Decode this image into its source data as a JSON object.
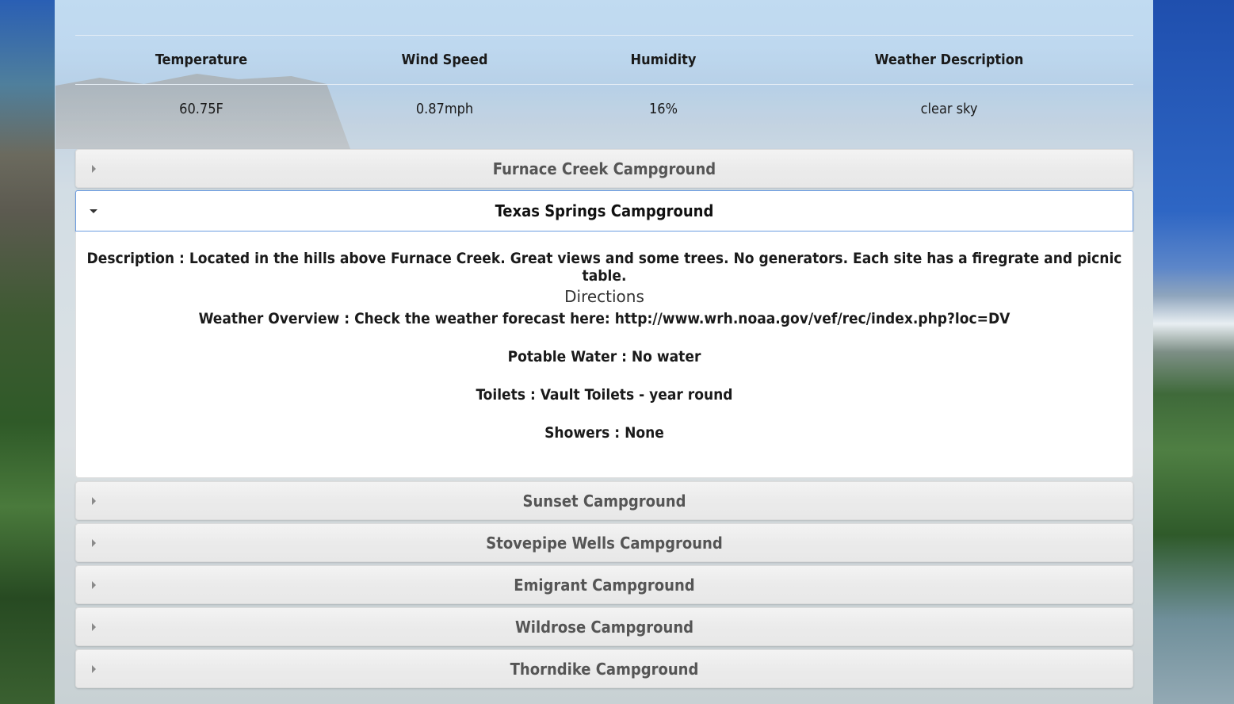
{
  "weather": {
    "headers": [
      "Temperature",
      "Wind Speed",
      "Humidity",
      "Weather Description"
    ],
    "values": [
      "60.75F",
      "0.87mph",
      "16%",
      "clear sky"
    ]
  },
  "campgrounds": [
    {
      "name": "Furnace Creek Campground",
      "expanded": false
    },
    {
      "name": "Texas Springs Campground",
      "expanded": true
    },
    {
      "name": "Sunset Campground",
      "expanded": false
    },
    {
      "name": "Stovepipe Wells Campground",
      "expanded": false
    },
    {
      "name": "Emigrant Campground",
      "expanded": false
    },
    {
      "name": "Wildrose Campground",
      "expanded": false
    },
    {
      "name": "Thorndike Campground",
      "expanded": false
    }
  ],
  "details": {
    "description_label": "Description",
    "description": "Located in the hills above Furnace Creek. Great views and some trees. No generators. Each site has a firegrate and picnic table.",
    "directions_label": "Directions",
    "weather_label": "Weather Overview",
    "weather": "Check the weather forecast here: http://www.wrh.noaa.gov/vef/rec/index.php?loc=DV",
    "water_label": "Potable Water",
    "water": "No water",
    "toilets_label": "Toilets",
    "toilets": "Vault Toilets - year round",
    "showers_label": "Showers",
    "showers": "None",
    "separator": " : "
  },
  "colors": {
    "accent_border": "#6a9be0",
    "panel_top": "#b4d3ee"
  }
}
